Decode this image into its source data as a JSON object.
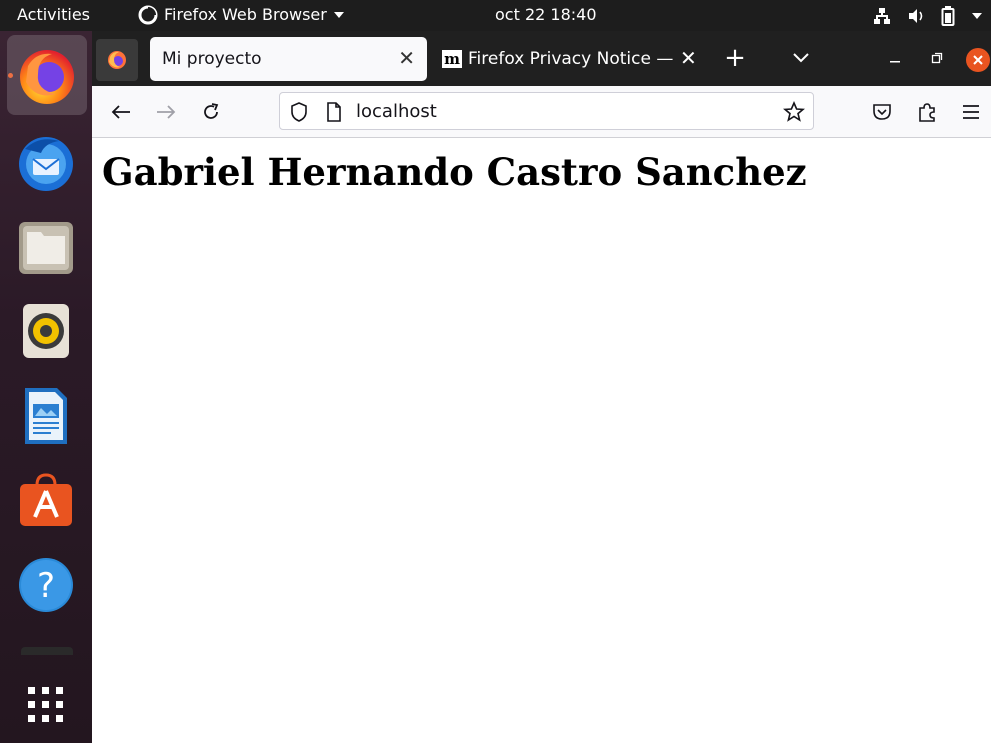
{
  "topbar": {
    "activities": "Activities",
    "app_name": "Firefox Web Browser",
    "clock": "oct 22  18:40"
  },
  "dock": {
    "items": [
      "firefox",
      "thunderbird",
      "files",
      "rhythmbox",
      "libreoffice-writer",
      "ubuntu-software",
      "help",
      "show-applications"
    ]
  },
  "browser": {
    "tabs": [
      {
        "label": "Mi proyecto",
        "active": true
      },
      {
        "label": "Firefox Privacy Notice —",
        "active": false
      }
    ],
    "new_tab": "+",
    "url": "localhost"
  },
  "page": {
    "heading": "Gabriel Hernando Castro Sanchez"
  },
  "colors": {
    "ubuntu_orange": "#e95420",
    "close_button": "#e95420",
    "tab_bg": "#202020",
    "toolbar_bg": "#f9f9fb"
  }
}
